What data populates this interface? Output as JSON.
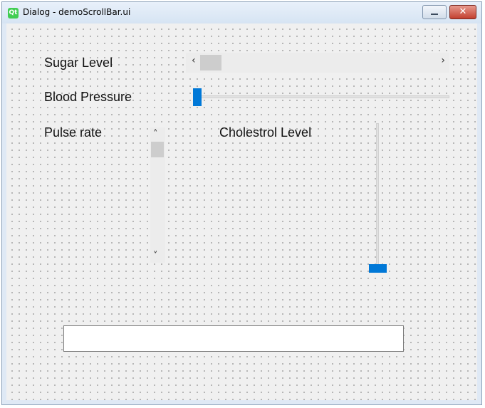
{
  "window": {
    "title": "Dialog - demoScrollBar.ui",
    "app_icon_text": "Qt",
    "close_glyph": "✕"
  },
  "controls": {
    "sugar_level": {
      "label": "Sugar Level",
      "value_fraction": 0.0,
      "left_arrow": "‹",
      "right_arrow": "›"
    },
    "blood_pressure": {
      "label": "Blood Pressure",
      "value_fraction": 0.0
    },
    "pulse_rate": {
      "label": "Pulse rate",
      "value_fraction": 0.0,
      "up_arrow": "˄",
      "down_arrow": "˅"
    },
    "cholestrol_level": {
      "label": "Cholestrol Level",
      "value_fraction": 0.0
    },
    "output": {
      "value": ""
    }
  },
  "colors": {
    "accent": "#0078d7",
    "thumb": "#cdcdcd",
    "close_button": "#c3402f"
  }
}
